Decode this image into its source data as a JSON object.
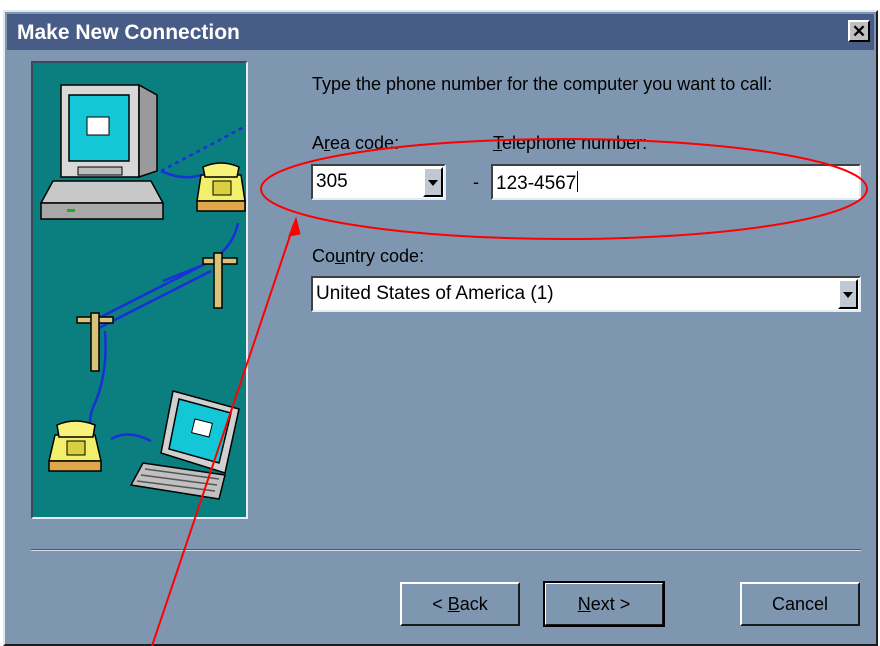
{
  "window": {
    "title": "Make New Connection",
    "close_glyph": "✕"
  },
  "prompt": "Type the phone number for the computer you want to call:",
  "area_code": {
    "label_before": "A",
    "label_mnemonic": "r",
    "label_after": "ea code:",
    "value": "305"
  },
  "separator_dash": "-",
  "telephone": {
    "label_mnemonic": "T",
    "label_after": "elephone number:",
    "value": "123-4567"
  },
  "country_code": {
    "label_before": "Co",
    "label_mnemonic": "u",
    "label_after": "ntry code:",
    "value": "United States of America (1)"
  },
  "buttons": {
    "back_prefix": "< ",
    "back_mnemonic": "B",
    "back_suffix": "ack",
    "next_mnemonic": "N",
    "next_suffix": "ext >",
    "cancel": "Cancel"
  },
  "annotation": {
    "color": "#ff0000"
  },
  "colors": {
    "dialog_bg": "#7f96b1",
    "titlebar_bg": "#475c86",
    "illustration_bg": "#0b7f80"
  }
}
